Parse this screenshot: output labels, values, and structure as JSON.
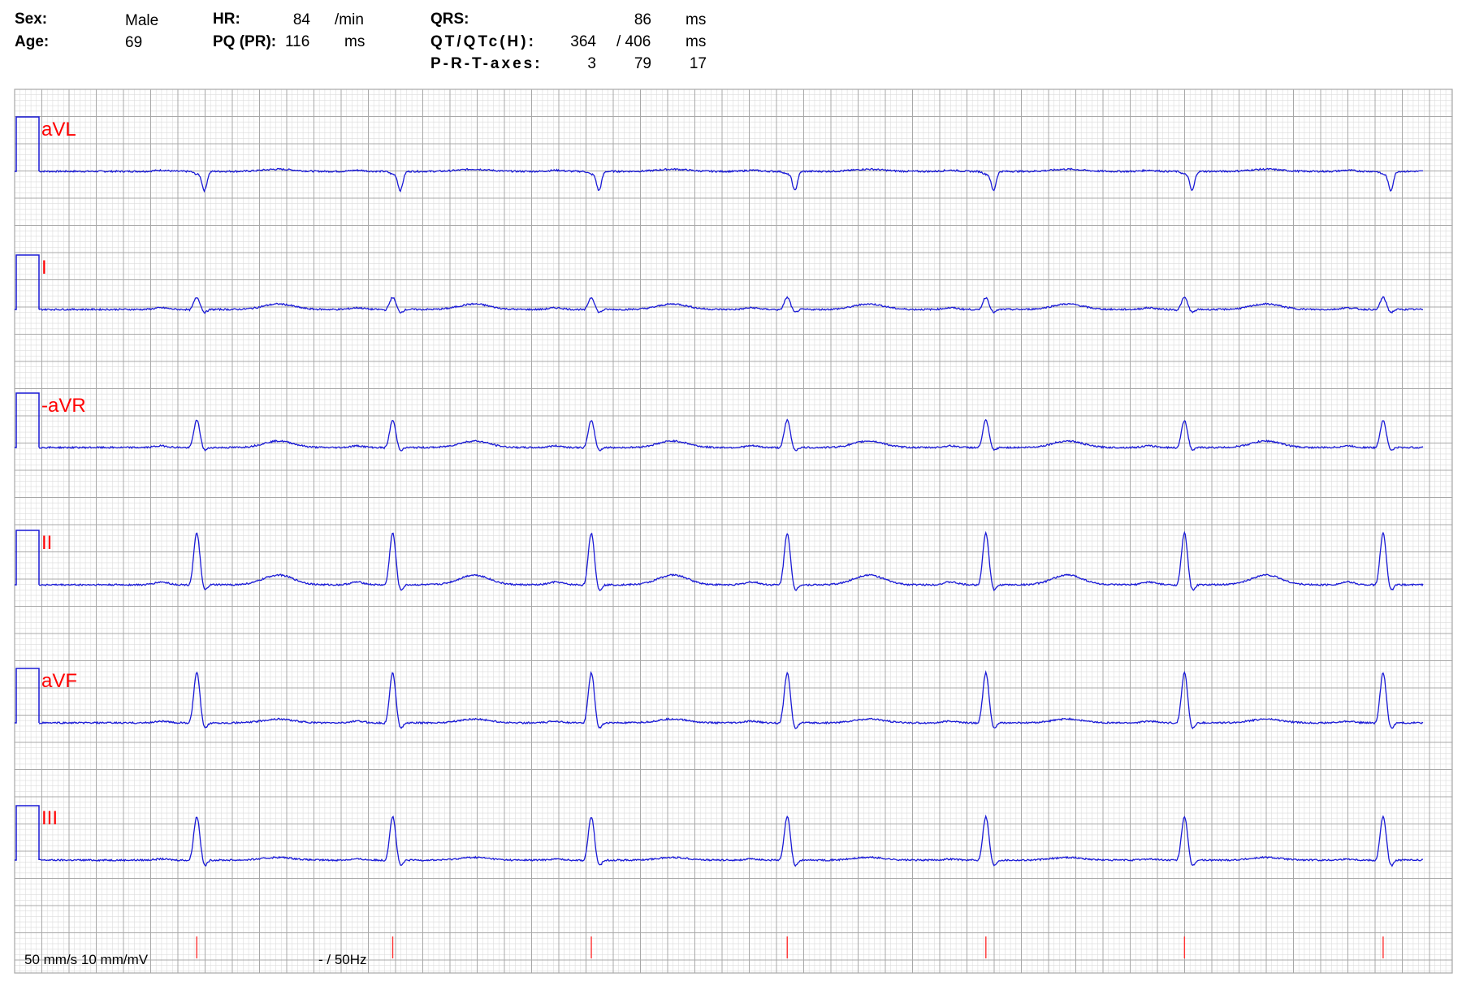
{
  "header": {
    "sex_label": "Sex:",
    "sex_value": "Male",
    "age_label": "Age:",
    "age_value": "69",
    "hr_label": "HR:",
    "hr_value": "84",
    "hr_unit": "/min",
    "pq_label": "PQ (PR):",
    "pq_value": "116",
    "pq_unit": "ms",
    "qrs_label": "QRS:",
    "qrs_value": "86",
    "qrs_unit": "ms",
    "qt_label": "QT/QTc(H):",
    "qt_value": "364",
    "qtc_value": "/ 406",
    "qt_unit": "ms",
    "axes_label": "P-R-T-axes:",
    "p_axis": "3",
    "r_axis": "79",
    "t_axis": "17"
  },
  "footer": {
    "speed_gain": "50 mm/s 10 mm/mV",
    "filter": "- / 50Hz"
  },
  "colors": {
    "trace": "#1a1ad6",
    "label": "#ff0000",
    "grid_major": "#a8a8a8",
    "grid_minor": "#dcdcdc",
    "beat_marker": "#ff3333"
  },
  "chart_data": {
    "type": "line",
    "title": "",
    "paper_speed_mm_per_s": 50,
    "gain_mm_per_mV": 10,
    "grid": true,
    "leads": [
      {
        "name": "aVL",
        "r": -0.05,
        "q": 0.0,
        "s": -0.35,
        "t": 0.04,
        "p": 0.02
      },
      {
        "name": "I",
        "r": 0.22,
        "q": -0.02,
        "s": -0.06,
        "t": 0.1,
        "p": 0.03
      },
      {
        "name": "-aVR",
        "r": 0.5,
        "q": -0.02,
        "s": -0.06,
        "t": 0.12,
        "p": 0.03
      },
      {
        "name": "II",
        "r": 0.95,
        "q": -0.03,
        "s": -0.12,
        "t": 0.18,
        "p": 0.05
      },
      {
        "name": "aVF",
        "r": 0.92,
        "q": -0.03,
        "s": -0.12,
        "t": 0.07,
        "p": 0.03
      },
      {
        "name": "III",
        "r": 0.8,
        "q": -0.03,
        "s": -0.12,
        "t": 0.05,
        "p": 0.02
      }
    ],
    "beat_times_s": [
      0.58,
      1.3,
      2.03,
      2.75,
      3.48,
      4.21,
      4.94
    ]
  }
}
